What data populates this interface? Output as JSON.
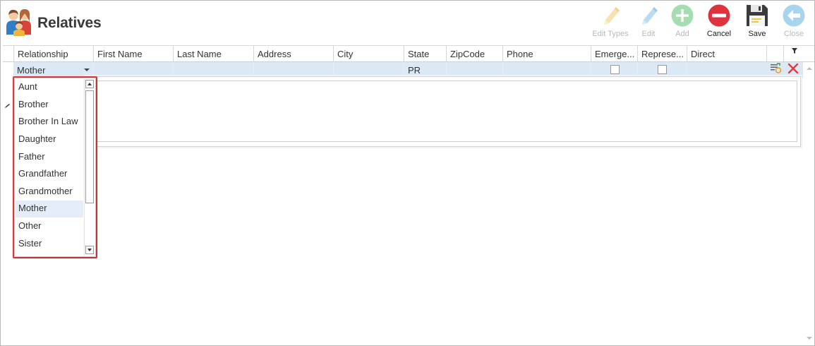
{
  "window": {
    "title": "Relatives"
  },
  "toolbar": {
    "edit_types": "Edit Types",
    "edit": "Edit",
    "add": "Add",
    "cancel": "Cancel",
    "save": "Save",
    "close": "Close"
  },
  "grid": {
    "columns": [
      "Relationship",
      "First Name",
      "Last Name",
      "Address",
      "City",
      "State",
      "ZipCode",
      "Phone",
      "Emerge...",
      "Represe...",
      "Direct"
    ],
    "edit_row": {
      "relationship": "Mother",
      "first_name": "",
      "last_name": "",
      "address": "",
      "city": "",
      "state": "PR",
      "zipcode": "",
      "phone": "",
      "emergency": false,
      "representative": false,
      "direct": ""
    }
  },
  "dropdown": {
    "options": [
      "Aunt",
      "Brother",
      "Brother In Law",
      "Daughter",
      "Father",
      "Grandfather",
      "Grandmother",
      "Mother",
      "Other",
      "Sister"
    ],
    "selected": "Mother"
  },
  "colors": {
    "edit_row_bg": "#dbe9f7",
    "highlight": "#e03c3c",
    "cancel_red": "#e0323c",
    "add_green": "#a6dcb2",
    "close_blue": "#a8d4ee"
  }
}
